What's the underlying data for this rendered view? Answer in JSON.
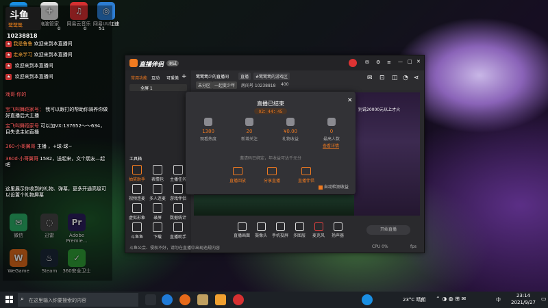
{
  "desktop": {
    "icons": [
      {
        "label": "腾讯QQ",
        "color": "#1a8fe3",
        "glyph": "Q"
      },
      {
        "label": "电脑管家",
        "color": "#e0e0e0",
        "glyph": "✚"
      },
      {
        "label": "网易云音乐",
        "color": "#d63031",
        "glyph": "♫"
      },
      {
        "label": "网易UU加速",
        "color": "#2d7dd2",
        "glyph": "◎"
      },
      {
        "label": "微信",
        "color": "#2aae67",
        "glyph": "✉"
      },
      {
        "label": "迅雷",
        "color": "#444",
        "glyph": "◌"
      },
      {
        "label": "Adobe Premie...",
        "color": "#2b1d5c",
        "glyph": "Pr"
      },
      {
        "label": "WeGame",
        "color": "#dd6a1a",
        "glyph": "W"
      },
      {
        "label": "Steam",
        "color": "#1b2838",
        "glyph": "♨"
      },
      {
        "label": "360安全卫士",
        "color": "#2f9e36",
        "glyph": "✓"
      }
    ]
  },
  "overlay": {
    "logo": "斗鱼",
    "streamer_name": "鹭鹭鸶",
    "room_id": "10238818",
    "stats": [
      "0",
      "0",
      "51"
    ],
    "chat": [
      {
        "user": "我是鲁鲁",
        "text": "欢迎来到本直播间"
      },
      {
        "user": "走来学习",
        "text": "欢迎来到本直播间"
      },
      {
        "user": "",
        "text": "欢迎来到本直播间"
      },
      {
        "user": "",
        "text": "欢迎来到本直播间"
      },
      {
        "user": "戏哥·你的",
        "text": ""
      },
      {
        "user": "宝飞叫舞蹈家号：",
        "text": "我可以跟打的帮助你骑养你做好直播后大主播"
      },
      {
        "user": "宝飞叫舞蹈家号",
        "text": "可以加VX:137652～～634，目失说主如直播"
      },
      {
        "user": "360·小哥翼哥",
        "text": "主播 ，+球-球~"
      },
      {
        "user": "360d·小哥翼哥",
        "text": "1582，送起来，文个朋友—起吧"
      },
      {
        "user": "",
        "text": "这里展示你收到的礼物、弹幕，更多开通高级可以设置个礼物屏幕"
      }
    ]
  },
  "app": {
    "name": "直播伴侣",
    "tag": "测试",
    "tabs": [
      "常用功能",
      "互动",
      "可爱美"
    ],
    "scene_label": "全屏 1",
    "toolbox_title": "工具箱",
    "tools": [
      "抽奖助手",
      "表情包",
      "主播任务",
      "视频连麦",
      "多人连麦",
      "游戏伴侣",
      "虚拟形象",
      "录屏",
      "数据统计",
      "斗鱼鱼",
      "下载",
      "直播助手"
    ],
    "bottom_notice": "斗鱼公会、侵权不好，请勿在直播中出现违规内容",
    "header_title": "鹭鹭鸶少的直播间",
    "header_chips": [
      "直播",
      "#鹭鹭鸶的游戏区",
      "未分区",
      "一起变少年"
    ],
    "header_room": "房间号 10238818",
    "header_count": "400",
    "bottom_tools": [
      "直播画面",
      "摄像头",
      "手机投屏",
      "多图层",
      "麦克风",
      "扬声器"
    ],
    "start_button": "开始直播",
    "cpu": "CPU 0%",
    "fps": "fps"
  },
  "modal": {
    "title": "直播已结束",
    "duration": "02：44：45",
    "stats": [
      {
        "value": "1380",
        "label": "观看热度"
      },
      {
        "value": "20",
        "label": "新增关注"
      },
      {
        "value": "¥0.00",
        "label": "礼物收益"
      },
      {
        "value": "0",
        "label": "最高人数"
      }
    ],
    "link_text": "查看详情",
    "invite": "邀请码已绑定，年收益可达千元分",
    "actions": [
      "直播回放",
      "分享直播",
      "直播伴侣"
    ],
    "checkbox": "自动检测收益"
  },
  "preview_text": "别说20000元以上才火",
  "taskbar": {
    "search_placeholder": "在这里输入你要搜索的内容",
    "weather": "23°C 晴朗",
    "time": "23:14",
    "date": "2021/9/27",
    "lang": "中"
  }
}
